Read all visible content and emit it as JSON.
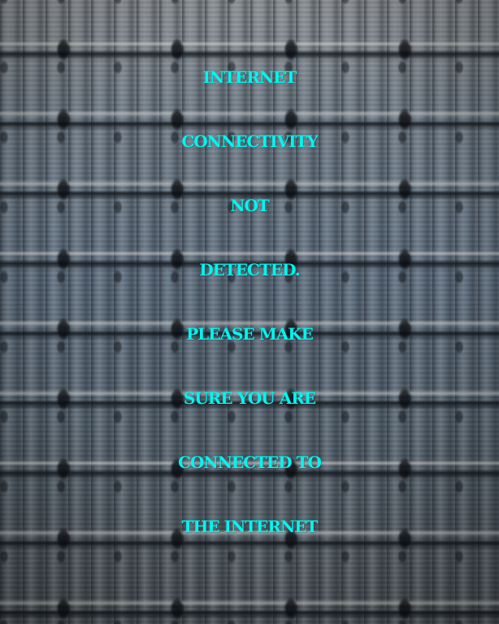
{
  "message": {
    "lines": [
      "INTERNET",
      "CONNECTIVITY",
      "NOT",
      "DETECTED.",
      "PLEASE MAKE",
      "SURE YOU ARE",
      "CONNECTED TO",
      "THE INTERNET"
    ],
    "color": "#00f5f0"
  },
  "background": {
    "icon": "temple-tower-facade-photo"
  }
}
